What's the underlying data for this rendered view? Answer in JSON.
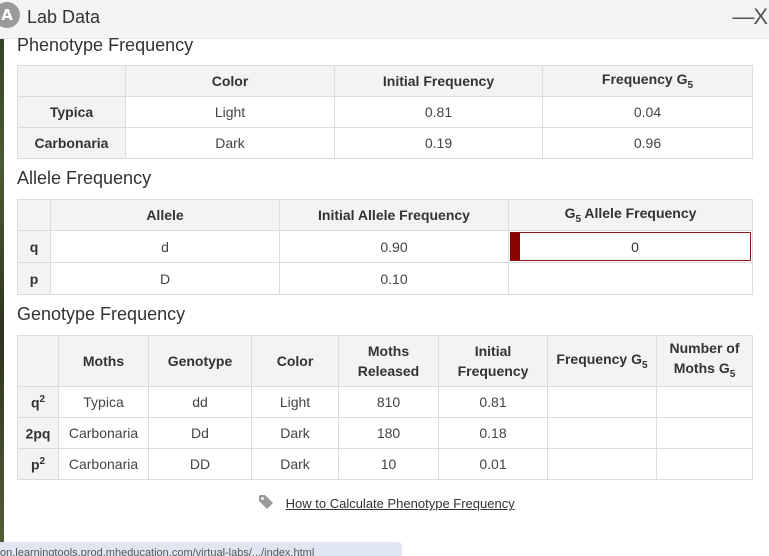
{
  "window": {
    "title": "Lab Data",
    "icon_letter": "A",
    "close_label": "—X"
  },
  "phenotype": {
    "title": "Phenotype Frequency",
    "headers": [
      "",
      "Color",
      "Initial Frequency",
      "Frequency G",
      "5"
    ],
    "rows": [
      {
        "name": "Typica",
        "color": "Light",
        "initial": "0.81",
        "g5": "0.04"
      },
      {
        "name": "Carbonaria",
        "color": "Dark",
        "initial": "0.19",
        "g5": "0.96"
      }
    ]
  },
  "allele": {
    "title": "Allele Frequency",
    "headers": {
      "allele": "Allele",
      "initial": "Initial Allele Frequency",
      "g5_pre": "G",
      "g5_sub": "5",
      "g5_post": " Allele Frequency"
    },
    "rows": [
      {
        "name": "q",
        "allele": "d",
        "initial": "0.90",
        "g5_value": "0"
      },
      {
        "name": "p",
        "allele": "D",
        "initial": "0.10",
        "g5_value": ""
      }
    ]
  },
  "genotype": {
    "title": "Genotype Frequency",
    "headers": {
      "moths": "Moths",
      "genotype": "Genotype",
      "color": "Color",
      "released_1": "Moths",
      "released_2": "Released",
      "initial_1": "Initial",
      "initial_2": "Frequency",
      "freq_g5": "Frequency G",
      "sub5": "5",
      "number_1": "Number of",
      "number_2": "Moths G"
    },
    "rows": [
      {
        "label": "q",
        "sup": "2",
        "moths": "Typica",
        "genotype": "dd",
        "color": "Light",
        "released": "810",
        "initial": "0.81"
      },
      {
        "label": "2pq",
        "sup": "",
        "moths": "Carbonaria",
        "genotype": "Dd",
        "color": "Dark",
        "released": "180",
        "initial": "0.18"
      },
      {
        "label": "p",
        "sup": "2",
        "moths": "Carbonaria",
        "genotype": "DD",
        "color": "Dark",
        "released": "10",
        "initial": "0.01"
      }
    ]
  },
  "help_link": "How to Calculate Phenotype Frequency",
  "status_url": "on.learningtools.prod.mheducation.com/virtual-labs/.../index.html"
}
